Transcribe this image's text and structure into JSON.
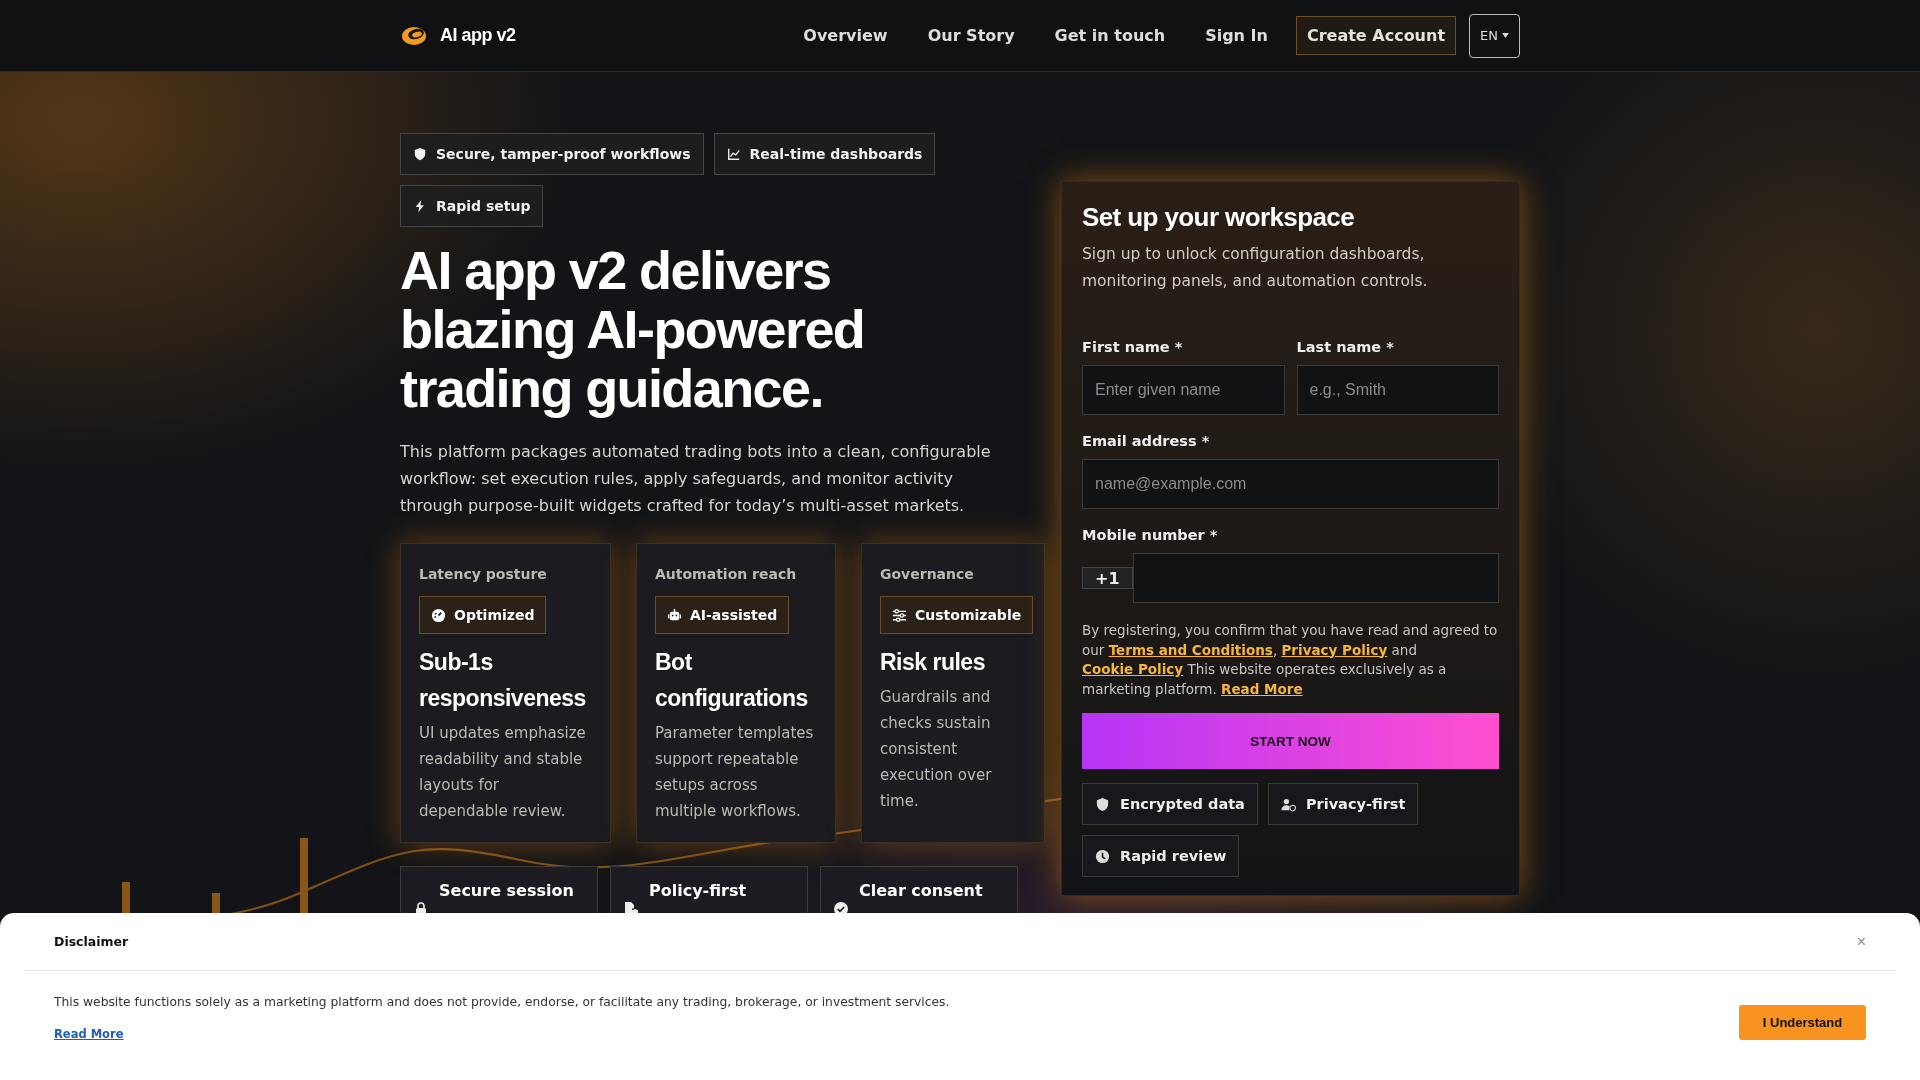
{
  "nav": {
    "brand": "AI app v2",
    "links": [
      "Overview",
      "Our Story",
      "Get in touch",
      "Sign In"
    ],
    "cta": "Create Account",
    "language": "EN"
  },
  "hero": {
    "badges": [
      {
        "kind": "shield",
        "label": "Secure, tamper-proof workflows"
      },
      {
        "kind": "chart",
        "label": "Real-time dashboards"
      },
      {
        "kind": "bolt",
        "label": "Rapid setup"
      }
    ],
    "headline": "AI app v2 delivers blazing AI-powered trading guidance.",
    "intro": "This platform packages automated trading bots into a clean, configurable workflow: set execution rules, apply safeguards, and monitor activity through purpose-built widgets crafted for today’s multi-asset markets.",
    "cards": [
      {
        "eyebrow": "Latency posture",
        "tag": {
          "kind": "gauge",
          "label": "Optimized"
        },
        "title": "Sub-1s responsiveness",
        "text": "UI updates emphasize readability and stable layouts for dependable review."
      },
      {
        "eyebrow": "Automation reach",
        "tag": {
          "kind": "robot",
          "label": "AI-assisted"
        },
        "title": "Bot configurations",
        "text": "Parameter templates support repeatable setups across multiple workflows."
      },
      {
        "eyebrow": "Governance",
        "tag": {
          "kind": "sliders",
          "label": "Customizable"
        },
        "title": "Risk rules",
        "text": "Guardrails and checks sustain consistent execution over time."
      }
    ],
    "features": [
      {
        "kind": "lock",
        "label": "Secure session"
      },
      {
        "kind": "file-shield",
        "label": "Policy-first"
      },
      {
        "kind": "check-circle",
        "label": "Clear consent"
      }
    ]
  },
  "form": {
    "title": "Set up your workspace",
    "subtitle": "Sign up to unlock configuration dashboards, monitoring panels, and automation controls.",
    "first_name": {
      "label": "First name *",
      "placeholder": "Enter given name"
    },
    "last_name": {
      "label": "Last name *",
      "placeholder": "e.g., Smith"
    },
    "email": {
      "label": "Email address *",
      "placeholder": "name@example.com"
    },
    "mobile": {
      "label": "Mobile number *",
      "prefix": "+1"
    },
    "consent": [
      {
        "kind": "text",
        "text": "By registering, you confirm that you have read and agreed to our "
      },
      {
        "kind": "link",
        "text": "Terms and Conditions"
      },
      {
        "kind": "text",
        "text": ", "
      },
      {
        "kind": "link",
        "text": "Privacy Policy"
      },
      {
        "kind": "text",
        "text": " and "
      },
      {
        "kind": "link",
        "text": "Cookie Policy"
      },
      {
        "kind": "text",
        "text": " This website operates exclusively as a marketing platform. "
      },
      {
        "kind": "link",
        "text": "Read More"
      }
    ],
    "submit": "START NOW",
    "trust": [
      {
        "kind": "shield",
        "label": "Encrypted data"
      },
      {
        "kind": "user-shield",
        "label": "Privacy-first"
      },
      {
        "kind": "clock",
        "label": "Rapid review"
      }
    ]
  },
  "disclaimer": {
    "title": "Disclaimer",
    "close": "×",
    "text": "This website functions solely as a marketing platform and does not provide, endorse, or facilitate any trading, brokerage, or investment services.",
    "link": "Read More",
    "button": "I Understand"
  }
}
